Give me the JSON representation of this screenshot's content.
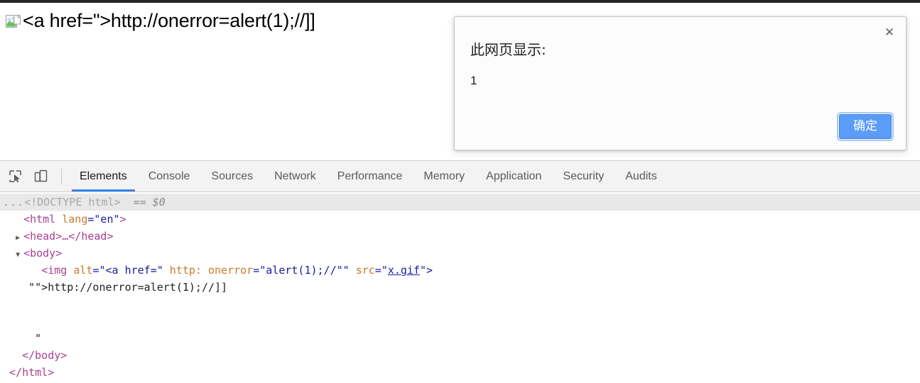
{
  "page": {
    "broken_image_icon": "broken-image-icon",
    "alt_text": "<a href=\">http://onerror=alert(1);//]]"
  },
  "dialog": {
    "title": "此网页显示:",
    "message": "1",
    "ok_label": "确定",
    "close_icon": "close-icon",
    "accent_color": "#5a9cf8"
  },
  "devtools": {
    "icons": {
      "inspect": "inspect-element-icon",
      "device": "device-toolbar-icon"
    },
    "tabs": [
      {
        "label": "Elements",
        "active": true
      },
      {
        "label": "Console",
        "active": false
      },
      {
        "label": "Sources",
        "active": false
      },
      {
        "label": "Network",
        "active": false
      },
      {
        "label": "Performance",
        "active": false
      },
      {
        "label": "Memory",
        "active": false
      },
      {
        "label": "Application",
        "active": false
      },
      {
        "label": "Security",
        "active": false
      },
      {
        "label": "Audits",
        "active": false
      }
    ],
    "active_tab_underline": "#2d8cf0",
    "dom": {
      "doctype_dots": "...",
      "doctype_text": "<!DOCTYPE html>",
      "doctype_selected_marker": "== $0",
      "html_open": "<html lang=\"en\">",
      "html_tag_open": "<html ",
      "html_attr_name": "lang",
      "html_attr_val": "=\"en\"",
      "html_attr_close": ">",
      "head_collapsed": "<head>…</head>",
      "body_open": "<body>",
      "img_tag": "<img ",
      "img_attr1_name": "alt",
      "img_attr1_val": "=\"<a href=\"",
      "img_attr1_tail": " http:",
      "img_attr2_name": " onerror",
      "img_attr2_val": "=\"alert(1);//\"\"",
      "img_attr3_name": " src",
      "img_attr3_eq": "=\"",
      "img_attr3_link": "x.gif",
      "img_attr3_close": "\">",
      "text_node_1": "\"\">http://onerror=alert(1);//]]",
      "text_node_2": "\"",
      "body_close": "</body>",
      "html_close": "</html>",
      "expand_collapsed": "▶",
      "expand_open": "▼"
    }
  }
}
